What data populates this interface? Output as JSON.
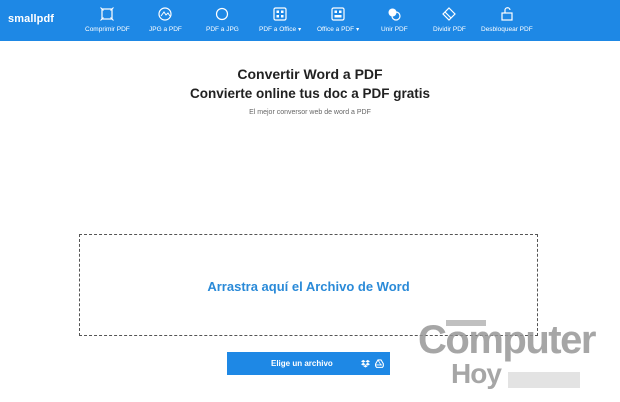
{
  "brand": {
    "name": "smallpdf"
  },
  "nav": {
    "items": [
      {
        "label": "Comprimir PDF",
        "icon": "compress-icon",
        "dropdown": false
      },
      {
        "label": "JPG a PDF",
        "icon": "jpg-to-pdf-icon",
        "dropdown": false
      },
      {
        "label": "PDF a JPG",
        "icon": "pdf-to-jpg-icon",
        "dropdown": false
      },
      {
        "label": "PDF a Office",
        "icon": "pdf-to-office-icon",
        "dropdown": true
      },
      {
        "label": "Office a PDF",
        "icon": "office-to-pdf-icon",
        "dropdown": true
      },
      {
        "label": "Unir PDF",
        "icon": "merge-icon",
        "dropdown": false
      },
      {
        "label": "Dividir PDF",
        "icon": "split-icon",
        "dropdown": false
      },
      {
        "label": "Desbloquear PDF",
        "icon": "unlock-icon",
        "dropdown": false
      }
    ]
  },
  "hero": {
    "title": "Convertir Word a PDF",
    "subtitle": "Convierte online tus doc a PDF gratis",
    "description": "El mejor conversor web de word a PDF"
  },
  "dropzone": {
    "label": "Arrastra aquí el Archivo de Word"
  },
  "choose_button": {
    "label": "Elige un archivo",
    "icons": [
      "dropbox-icon",
      "google-drive-icon"
    ]
  },
  "watermark": {
    "line1": "Computer",
    "line2": "Hoy"
  },
  "colors": {
    "accent": "#1e88e5",
    "drop_text": "#2a8ad8"
  }
}
